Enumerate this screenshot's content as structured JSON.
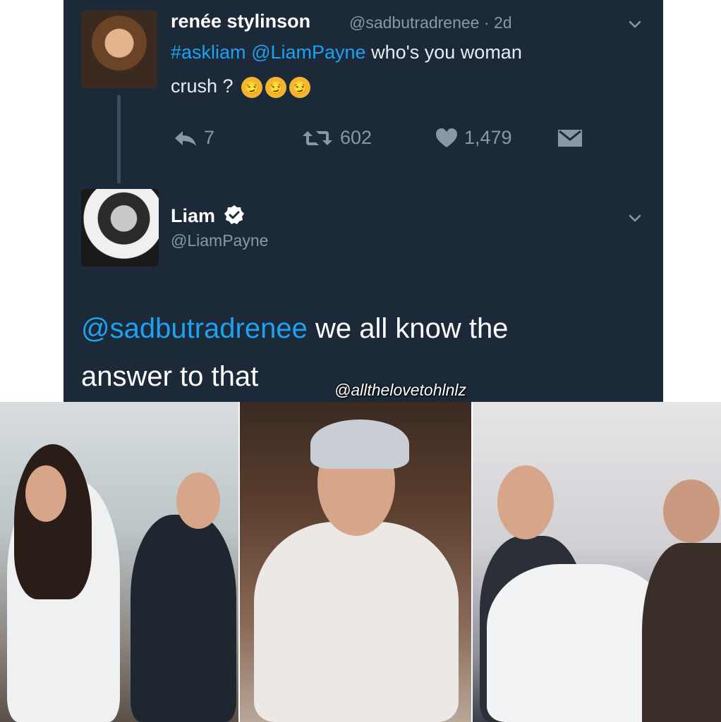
{
  "tweet1": {
    "name": "renée stylinson",
    "handle": "@sadbutradrenee",
    "sep": "·",
    "time": "2d",
    "hashtag": "#askliam",
    "mention": "@LiamPayne",
    "text_after": "who's you woman",
    "text_line2": "crush ?",
    "emoji_glyph": "😏",
    "reply_count": "7",
    "retweet_count": "602",
    "like_count": "1,479"
  },
  "tweet2": {
    "name": "Liam",
    "handle": "@LiamPayne",
    "mention": "@sadbutradrenee",
    "text_after": "we all know the",
    "text_line2": "answer to that"
  },
  "watermark": "@allthelovetohlnlz",
  "colors": {
    "panel_bg": "#1c2938",
    "link": "#1da1f2",
    "muted": "#8899a6",
    "text": "#e6ecf0",
    "verified": "#ffffff"
  },
  "icons": {
    "reply": "reply-icon",
    "retweet": "retweet-icon",
    "like": "heart-icon",
    "dm": "envelope-icon",
    "verified": "verified-badge-icon",
    "more": "chevron-down-icon"
  }
}
